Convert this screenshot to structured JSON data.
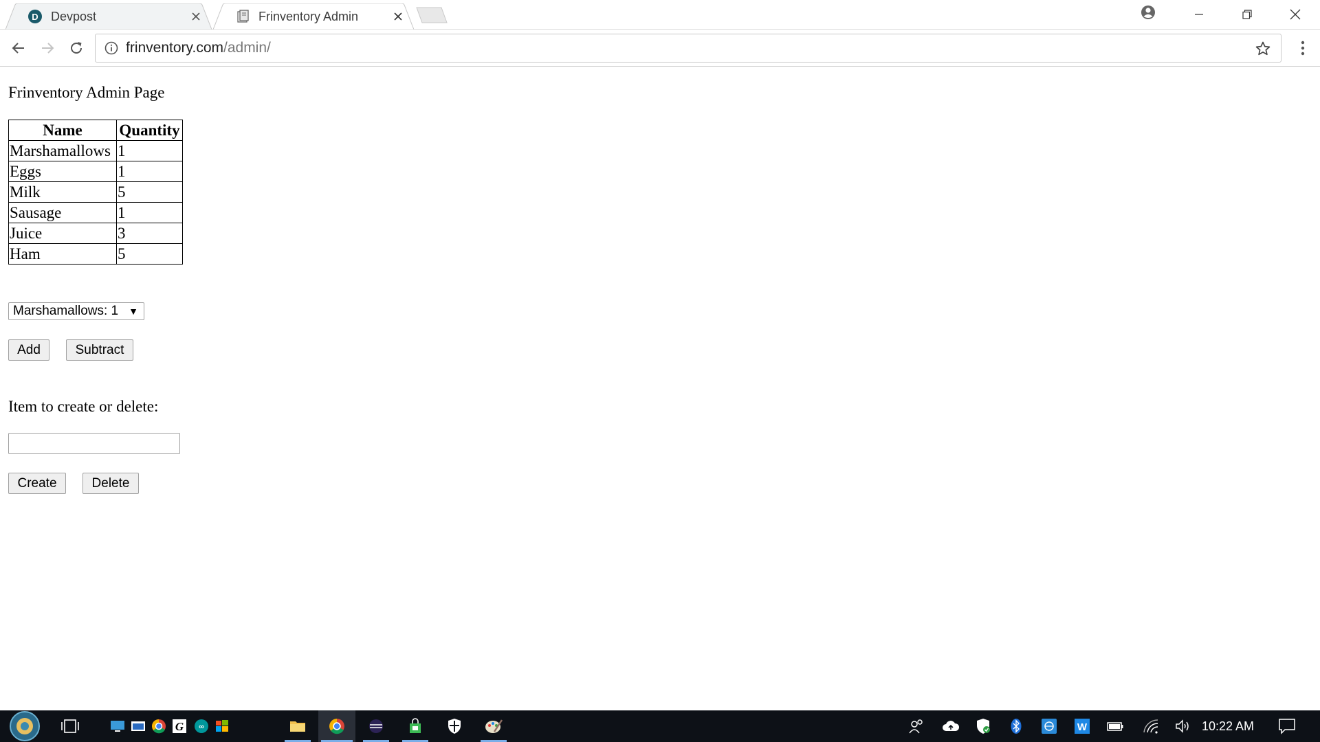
{
  "browser": {
    "tabs": [
      {
        "title": "Devpost",
        "active": false
      },
      {
        "title": "Frinventory Admin",
        "active": true
      }
    ],
    "url_host": "frinventory.com",
    "url_path": "/admin/"
  },
  "page": {
    "title": "Frinventory Admin Page",
    "table": {
      "headers": [
        "Name",
        "Quantity"
      ],
      "rows": [
        [
          "Marshamallows",
          "1"
        ],
        [
          "Eggs",
          "1"
        ],
        [
          "Milk",
          "5"
        ],
        [
          "Sausage",
          "1"
        ],
        [
          "Juice",
          "3"
        ],
        [
          "Ham",
          "5"
        ]
      ]
    },
    "select_value": "Marshamallows: 1",
    "add_label": "Add",
    "subtract_label": "Subtract",
    "prompt": "Item to create or delete:",
    "item_input_value": "",
    "create_label": "Create",
    "delete_label": "Delete"
  },
  "taskbar": {
    "time": "10:22 AM"
  },
  "colors": {
    "taskbar_bg": "#0d1117",
    "active_underline": "#7aaee8"
  }
}
